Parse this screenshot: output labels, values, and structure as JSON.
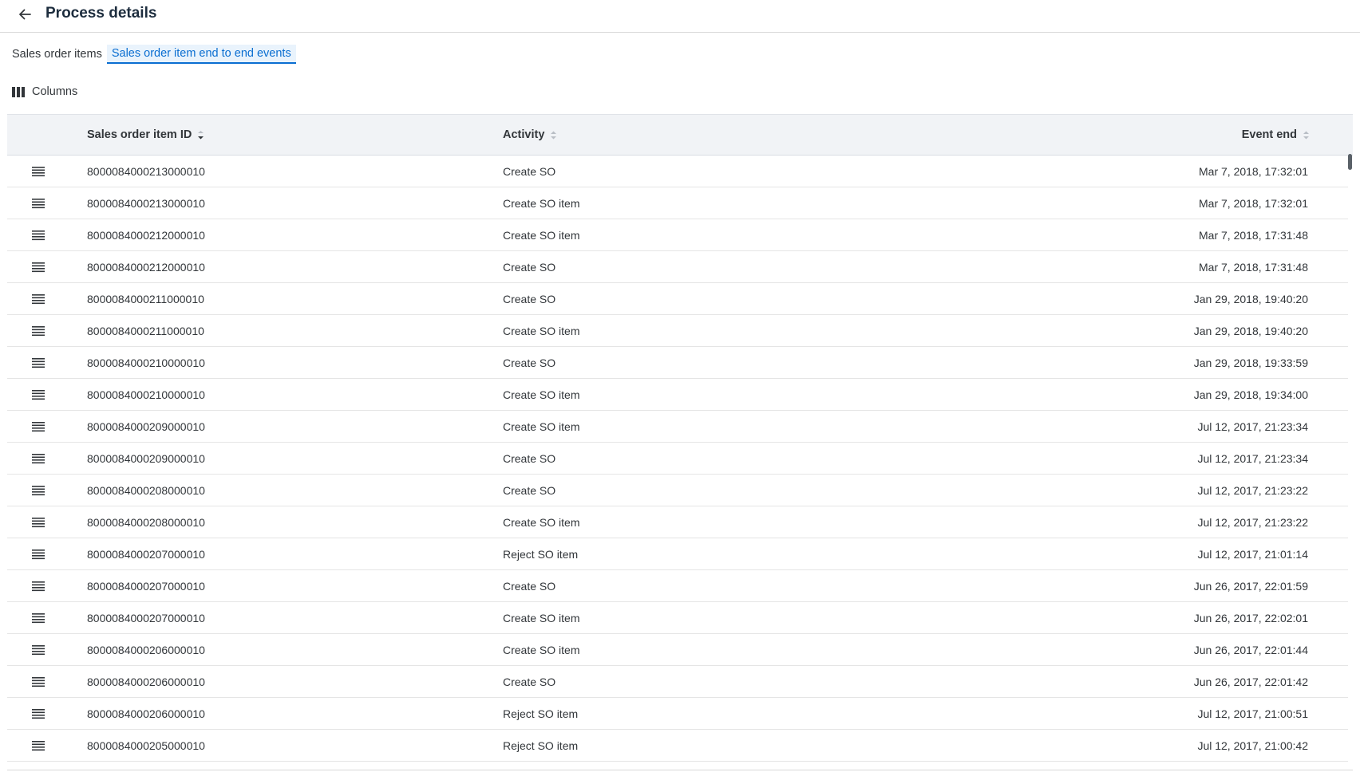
{
  "header": {
    "title": "Process details",
    "back_icon": "arrow-left-icon"
  },
  "tabs": [
    {
      "label": "Sales order items",
      "active": false
    },
    {
      "label": "Sales order item end to end events",
      "active": true
    }
  ],
  "toolbar": {
    "columns_label": "Columns",
    "columns_icon": "columns-icon"
  },
  "colors": {
    "accent": "#0a6ed1",
    "header_bg": "#f1f3f6",
    "row_border": "#e5e5e5"
  },
  "table": {
    "columns": [
      {
        "label": "Sales order item ID",
        "sort": "descending"
      },
      {
        "label": "Activity",
        "sort": "none"
      },
      {
        "label": "Event end",
        "sort": "none"
      }
    ],
    "rows": [
      {
        "id": "8000084000213000010",
        "activity": "Create SO",
        "event_end": "Mar 7, 2018, 17:32:01"
      },
      {
        "id": "8000084000213000010",
        "activity": "Create SO item",
        "event_end": "Mar 7, 2018, 17:32:01"
      },
      {
        "id": "8000084000212000010",
        "activity": "Create SO item",
        "event_end": "Mar 7, 2018, 17:31:48"
      },
      {
        "id": "8000084000212000010",
        "activity": "Create SO",
        "event_end": "Mar 7, 2018, 17:31:48"
      },
      {
        "id": "8000084000211000010",
        "activity": "Create SO",
        "event_end": "Jan 29, 2018, 19:40:20"
      },
      {
        "id": "8000084000211000010",
        "activity": "Create SO item",
        "event_end": "Jan 29, 2018, 19:40:20"
      },
      {
        "id": "8000084000210000010",
        "activity": "Create SO",
        "event_end": "Jan 29, 2018, 19:33:59"
      },
      {
        "id": "8000084000210000010",
        "activity": "Create SO item",
        "event_end": "Jan 29, 2018, 19:34:00"
      },
      {
        "id": "8000084000209000010",
        "activity": "Create SO item",
        "event_end": "Jul 12, 2017, 21:23:34"
      },
      {
        "id": "8000084000209000010",
        "activity": "Create SO",
        "event_end": "Jul 12, 2017, 21:23:34"
      },
      {
        "id": "8000084000208000010",
        "activity": "Create SO",
        "event_end": "Jul 12, 2017, 21:23:22"
      },
      {
        "id": "8000084000208000010",
        "activity": "Create SO item",
        "event_end": "Jul 12, 2017, 21:23:22"
      },
      {
        "id": "8000084000207000010",
        "activity": "Reject SO item",
        "event_end": "Jul 12, 2017, 21:01:14"
      },
      {
        "id": "8000084000207000010",
        "activity": "Create SO",
        "event_end": "Jun 26, 2017, 22:01:59"
      },
      {
        "id": "8000084000207000010",
        "activity": "Create SO item",
        "event_end": "Jun 26, 2017, 22:02:01"
      },
      {
        "id": "8000084000206000010",
        "activity": "Create SO item",
        "event_end": "Jun 26, 2017, 22:01:44"
      },
      {
        "id": "8000084000206000010",
        "activity": "Create SO",
        "event_end": "Jun 26, 2017, 22:01:42"
      },
      {
        "id": "8000084000206000010",
        "activity": "Reject SO item",
        "event_end": "Jul 12, 2017, 21:00:51"
      },
      {
        "id": "8000084000205000010",
        "activity": "Reject SO item",
        "event_end": "Jul 12, 2017, 21:00:42"
      }
    ]
  }
}
